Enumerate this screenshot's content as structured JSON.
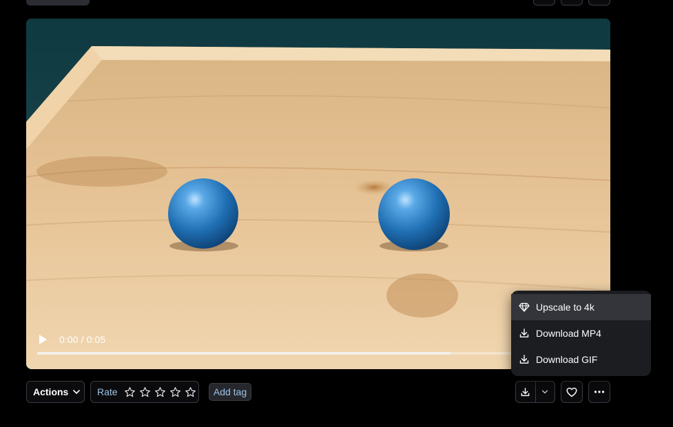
{
  "video": {
    "time_display": "0:00 / 0:05",
    "progress_fraction": 0.75
  },
  "toolbar": {
    "actions_label": "Actions",
    "rate_label": "Rate",
    "stars": 5,
    "rating": 0,
    "add_tag_label": "Add tag"
  },
  "menu": {
    "items": [
      {
        "label": "Upscale to 4k",
        "icon": "diamond-icon"
      },
      {
        "label": "Download MP4",
        "icon": "download-icon"
      },
      {
        "label": "Download GIF",
        "icon": "download-icon"
      }
    ]
  },
  "colors": {
    "background": "#000000",
    "menu_bg": "#1c1d21",
    "menu_active": "#33353b",
    "accent_text": "#9fc3e6",
    "ball_blue": "#2f7fc0",
    "wood": "#e0b98a"
  }
}
